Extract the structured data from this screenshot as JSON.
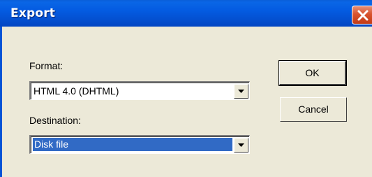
{
  "window": {
    "title": "Export"
  },
  "format": {
    "label": "Format:",
    "selected": "HTML 4.0 (DHTML)"
  },
  "destination": {
    "label": "Destination:",
    "selected": "Disk file"
  },
  "buttons": {
    "ok_label": "OK",
    "cancel_label": "Cancel"
  },
  "icons": {
    "close": "close-icon",
    "dropdown": "chevron-down-icon"
  },
  "colors": {
    "titlebar": "#0454d6",
    "dialog_face": "#ece9d8",
    "selection": "#316ac5",
    "close_button": "#d8532e"
  }
}
